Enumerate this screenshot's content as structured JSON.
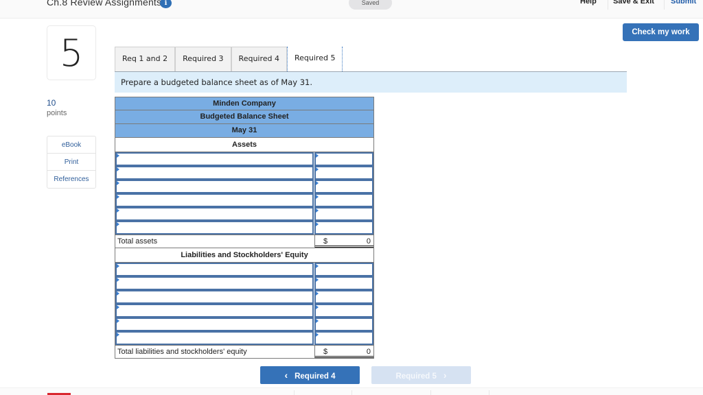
{
  "header": {
    "title": "Ch.8 Review Assignments",
    "info_badge": "i",
    "save_status": "Saved",
    "links": {
      "help": "Help",
      "save_exit": "Save & Exit",
      "submit": "Submit"
    },
    "check_my_work": "Check my work"
  },
  "question": {
    "number": "5",
    "points_value": "10",
    "points_label": "points"
  },
  "tools": [
    {
      "label": "eBook"
    },
    {
      "label": "Print"
    },
    {
      "label": "References"
    }
  ],
  "tabs": [
    {
      "label": "Req 1 and 2",
      "active": false
    },
    {
      "label": "Required 3",
      "active": false
    },
    {
      "label": "Required 4",
      "active": false
    },
    {
      "label": "Required 5",
      "active": true
    }
  ],
  "prompt": "Prepare a budgeted balance sheet as of May 31.",
  "sheet": {
    "company": "Minden Company",
    "title": "Budgeted Balance Sheet",
    "date": "May 31",
    "assets_heading": "Assets",
    "asset_rows": [
      {
        "label": "",
        "amount": ""
      },
      {
        "label": "",
        "amount": ""
      },
      {
        "label": "",
        "amount": ""
      },
      {
        "label": "",
        "amount": ""
      },
      {
        "label": "",
        "amount": ""
      },
      {
        "label": "",
        "amount": ""
      }
    ],
    "total_assets": {
      "label": "Total assets",
      "currency": "$",
      "value": "0"
    },
    "liabilities_heading": "Liabilities and Stockholders' Equity",
    "liability_rows": [
      {
        "label": "",
        "amount": ""
      },
      {
        "label": "",
        "amount": ""
      },
      {
        "label": "",
        "amount": ""
      },
      {
        "label": "",
        "amount": ""
      },
      {
        "label": "",
        "amount": ""
      },
      {
        "label": "",
        "amount": ""
      }
    ],
    "total_liabilities": {
      "label": "Total liabilities and stockholders' equity",
      "currency": "$",
      "value": "0"
    }
  },
  "navigation": {
    "prev_label": "Required 4",
    "prev_icon": "‹",
    "next_label": "Required 5",
    "next_icon": "›"
  },
  "colors": {
    "accent": "#3572b8",
    "table_header": "#79ade3",
    "prompt_bg": "#ddeefa",
    "next_disabled": "#d6e2f2"
  }
}
